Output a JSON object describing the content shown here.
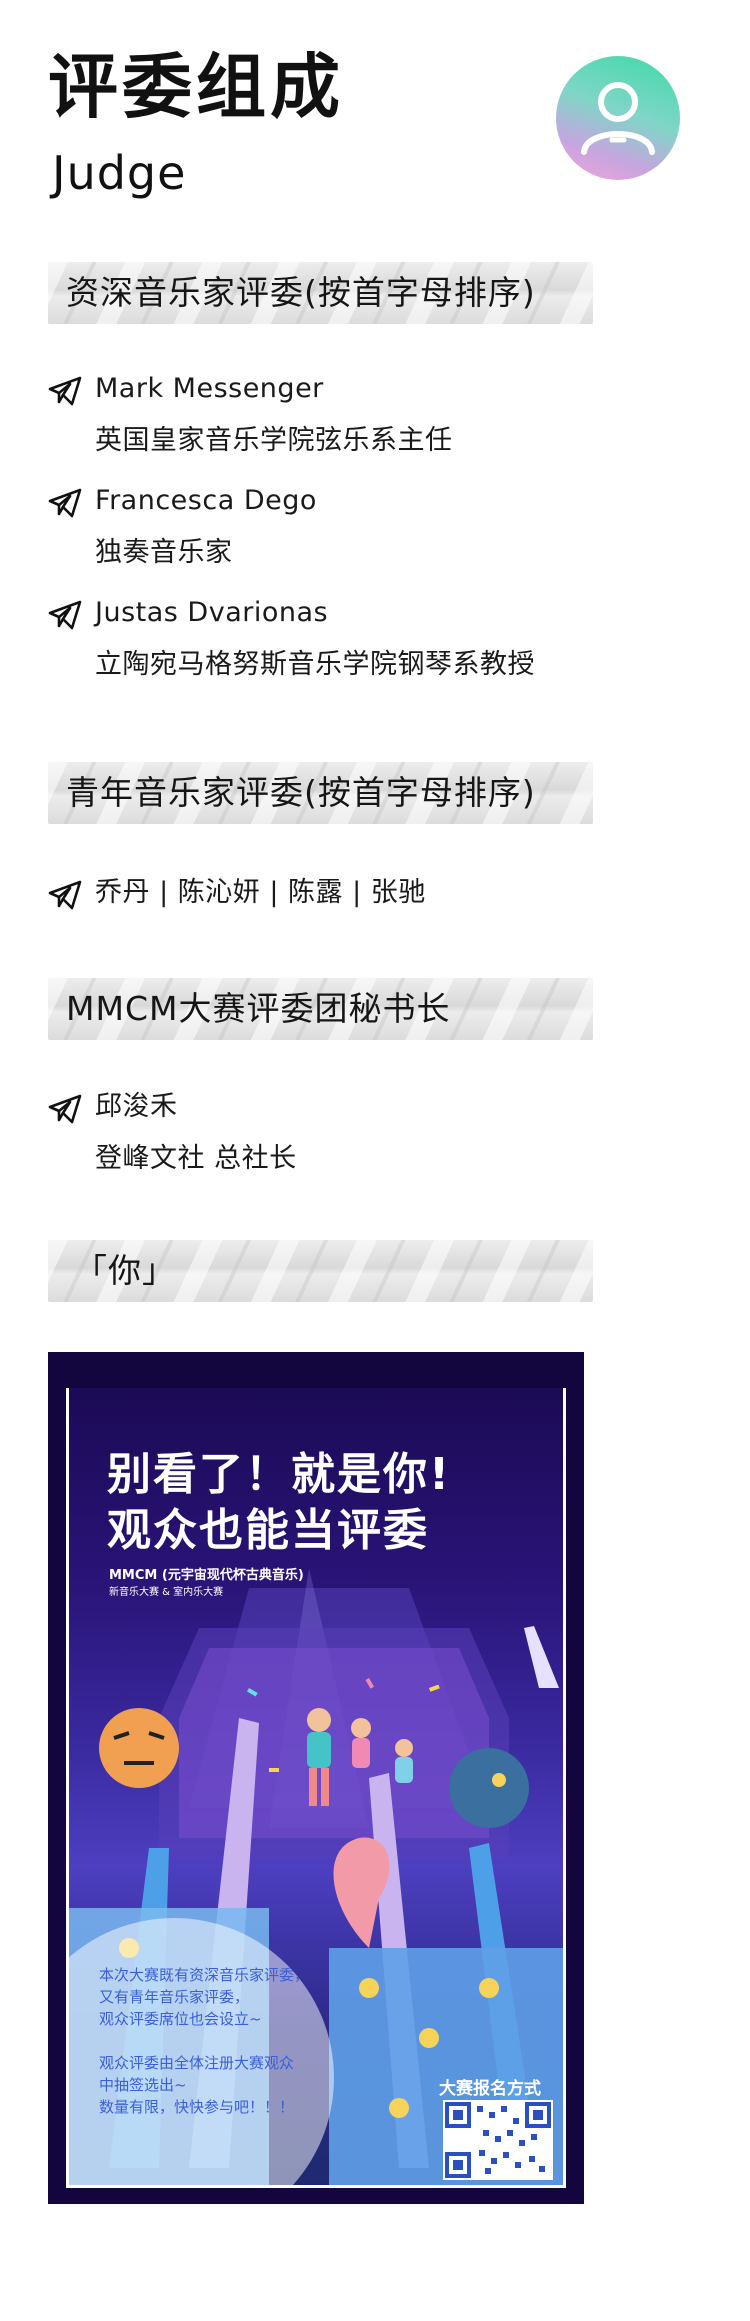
{
  "header": {
    "title_cn": "评委组成",
    "title_en": "Judge"
  },
  "sections": {
    "senior": {
      "heading": "资深音乐家评委(按首字母排序)",
      "judges": [
        {
          "name": "Mark Messenger",
          "title": "英国皇家音乐学院弦乐系主任"
        },
        {
          "name": "Francesca Dego",
          "title": "独奏音乐家"
        },
        {
          "name": "Justas Dvarionas",
          "title": "立陶宛马格努斯音乐学院钢琴系教授"
        }
      ]
    },
    "young": {
      "heading": "青年音乐家评委(按首字母排序)",
      "names_line": "乔丹 | 陈沁妍 | 陈露 | 张驰"
    },
    "secretary": {
      "heading": "MMCM大赛评委团秘书长",
      "name": "邱浚禾",
      "title": "登峰文社 总社长"
    },
    "you": {
      "heading": "「你」"
    }
  },
  "poster": {
    "title_line1": "别看了！就是你!",
    "title_line2": "观众也能当评委",
    "subtitle1": "MMCM (元宇宙现代杯古典音乐)",
    "subtitle2": "新音乐大赛 & 室内乐大赛",
    "body_lines": [
      "本次大赛既有资深音乐家评委，",
      "又有青年音乐家评委，",
      "观众评委席位也会设立~",
      "",
      "观众评委由全体注册大赛观众",
      "中抽签选出~",
      "数量有限，快快参与吧！！！"
    ],
    "qr_label": "大赛报名方式"
  },
  "colors": {
    "poster_bg": "#13063f",
    "poster_text_blue": "#3a5fd6",
    "avatar_gradient_start": "#3fd9a8",
    "avatar_gradient_end": "#f5a3d7"
  }
}
